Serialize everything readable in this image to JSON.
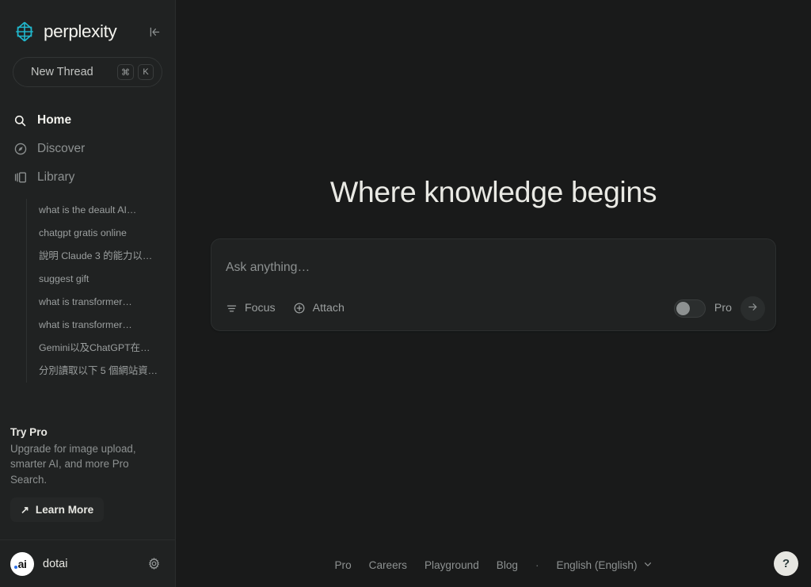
{
  "brand": {
    "name": "perplexity",
    "logo_icon": "perplexity-snowflake-logo",
    "logo_color": "#20b8cd"
  },
  "sidebar": {
    "collapse_icon": "collapse-sidebar-icon",
    "new_thread": {
      "label": "New Thread",
      "keys": [
        "⌘",
        "K"
      ]
    },
    "nav": [
      {
        "label": "Home",
        "icon": "search-icon",
        "active": true
      },
      {
        "label": "Discover",
        "icon": "compass-icon",
        "active": false
      },
      {
        "label": "Library",
        "icon": "library-icon",
        "active": false
      }
    ],
    "threads": [
      {
        "label": "what is the deault AI…"
      },
      {
        "label": "chatgpt gratis online"
      },
      {
        "label": "說明 Claude 3 的能力以…"
      },
      {
        "label": "suggest gift"
      },
      {
        "label": "what is transformer…"
      },
      {
        "label": "what is transformer…"
      },
      {
        "label": "Gemini以及ChatGPT在…"
      },
      {
        "label": "分別讀取以下 5 個網站資…"
      }
    ],
    "try_pro": {
      "title": "Try Pro",
      "description": "Upgrade for image upload, smarter AI, and more Pro Search.",
      "button_label": "Learn More",
      "button_icon": "arrow-up-right-icon"
    },
    "user": {
      "avatar_text": "ai",
      "avatar_icon": "dotai-avatar",
      "username": "dotai",
      "settings_icon": "gear-icon"
    }
  },
  "main": {
    "hero_title": "Where knowledge begins",
    "search": {
      "placeholder": "Ask anything…",
      "value": "",
      "focus_label": "Focus",
      "focus_icon": "filter-sliders-icon",
      "attach_label": "Attach",
      "attach_icon": "plus-circle-icon",
      "pro_label": "Pro",
      "pro_enabled": false,
      "submit_icon": "arrow-right-icon"
    },
    "footer": {
      "links": [
        "Pro",
        "Careers",
        "Playground",
        "Blog"
      ],
      "separator": "·",
      "language": "English (English)",
      "language_icon": "chevron-down-icon"
    },
    "help": {
      "label": "?",
      "icon": "help-question-icon"
    }
  }
}
